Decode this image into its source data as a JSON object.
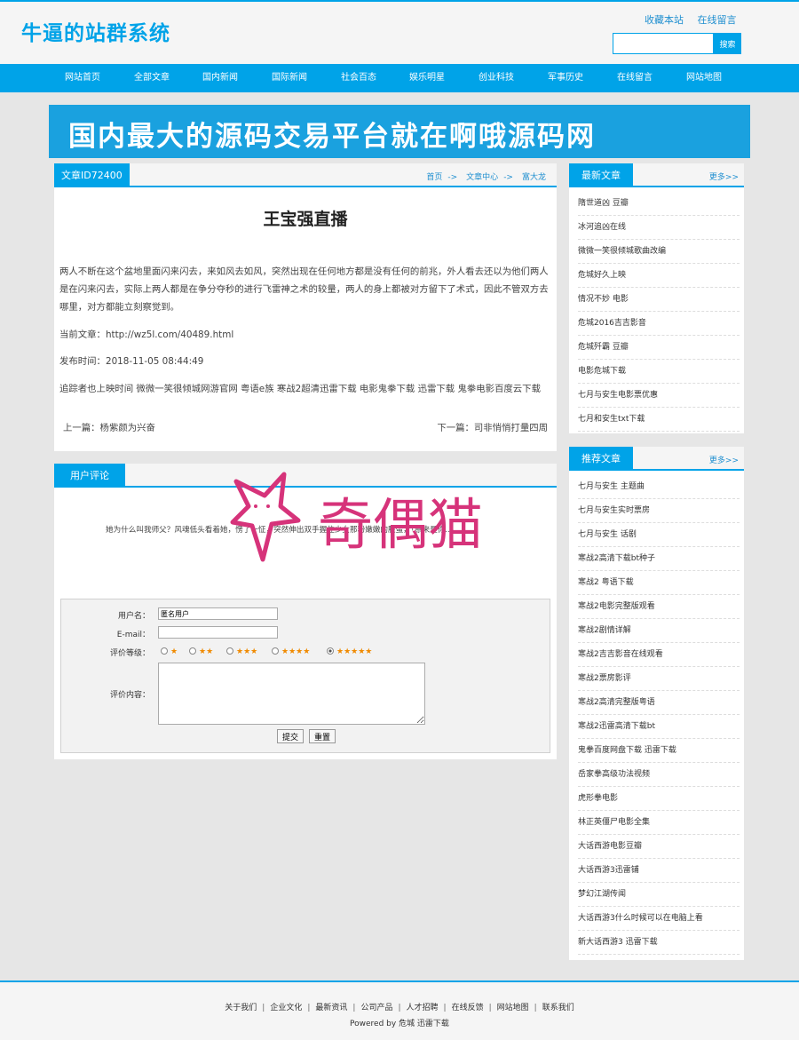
{
  "site": {
    "title": "牛逼的站群系统",
    "top_links": [
      "收藏本站",
      "在线留言"
    ],
    "search_placeholder": "",
    "search_button": "搜索"
  },
  "nav": [
    "网站首页",
    "全部文章",
    "国内新闻",
    "国际新闻",
    "社会百态",
    "娱乐明星",
    "创业科技",
    "军事历史",
    "在线留言",
    "网站地图"
  ],
  "banner": {
    "text": "国内最大的源码交易平台就在啊哦源码网"
  },
  "article": {
    "tab_label": "文章ID72400",
    "breadcrumb": [
      "首页",
      "文章中心",
      "富大龙"
    ],
    "breadcrumb_sep": "->",
    "title": "王宝强直播",
    "body": "两人不断在这个盆地里面闪来闪去，来如风去如风，突然出现在任何地方都是没有任何的前兆，外人看去还以为他们两人是在闪来闪去，实际上两人都是在争分夺秒的进行飞雷神之术的较量，两人的身上都被对方留下了术式，因此不管双方去哪里，对方都能立刻察觉到。",
    "current": "当前文章：http://wz5l.com/40489.html",
    "publish_time": "发布时间：2018-11-05 08:44:49",
    "tags": "追踪者也上映时间 微微一笑很倾城网游官网 粤语e族 寒战2超清迅雷下载 电影鬼拳下载 迅雷下载 鬼拳电影百度云下载",
    "prev": "上一篇：杨紫颜为兴奋",
    "next": "下一篇：司非悄悄打量四周"
  },
  "comments": {
    "tab_label": "用户评论",
    "text": "她为什么叫我师父？风魂低头看着她，愣了一怔，突然伸出双手握住少女那粉嫩嫩的脸蛋，「原来是你……」",
    "form": {
      "username_label": "用户名：",
      "username_value": "匿名用户",
      "email_label": "E-mail：",
      "email_value": "",
      "rating_label": "评价等级：",
      "ratings": [
        "★",
        "★★",
        "★★★",
        "★★★★",
        "★★★★★"
      ],
      "rating_selected": 5,
      "content_label": "评价内容：",
      "submit": "提交",
      "reset": "重置"
    }
  },
  "watermark": {
    "text": "奇偶猫"
  },
  "sidebar_latest": {
    "tab_label": "最新文章",
    "more": "更多>>",
    "items": [
      "隋世道凶 豆瓣",
      "冰河追凶在线",
      "微微一笑很倾城歌曲改编",
      "危城好久上映",
      "情况不妙 电影",
      "危城2016吉吉影音",
      "危城歼霸 豆瓣",
      "电影危城下载",
      "七月与安生电影票优惠",
      "七月和安生txt下载"
    ]
  },
  "sidebar_recommend": {
    "tab_label": "推荐文章",
    "more": "更多>>",
    "items": [
      "七月与安生 主题曲",
      "七月与安生实时票房",
      "七月与安生 话剧",
      "寒战2高清下载bt种子",
      "寒战2 粤语下载",
      "寒战2电影完整版观看",
      "寒战2剧情详解",
      "寒战2吉吉影音在线观看",
      "寒战2票房影评",
      "寒战2高清完整版粤语",
      "寒战2迅雷高清下载bt",
      "鬼拳百度网盘下载 迅雷下载",
      "岳家拳高级功法视频",
      "虎形拳电影",
      "林正英僵尸电影全集",
      "大话西游电影豆瓣",
      "大话西游3迅雷铺",
      "梦幻江湖传闻",
      "大话西游3什么时候可以在电脑上看",
      "新大话西游3 迅雷下载"
    ]
  },
  "footer": {
    "links": [
      "关于我们",
      "企业文化",
      "最新资讯",
      "公司产品",
      "人才招聘",
      "在线反馈",
      "网站地图",
      "联系我们"
    ],
    "sep": "|",
    "powered": "Powered by 危城 迅雷下载"
  },
  "colors": {
    "accent": "#00a3e8",
    "watermark": "#d6337a",
    "star": "#f08a00"
  }
}
